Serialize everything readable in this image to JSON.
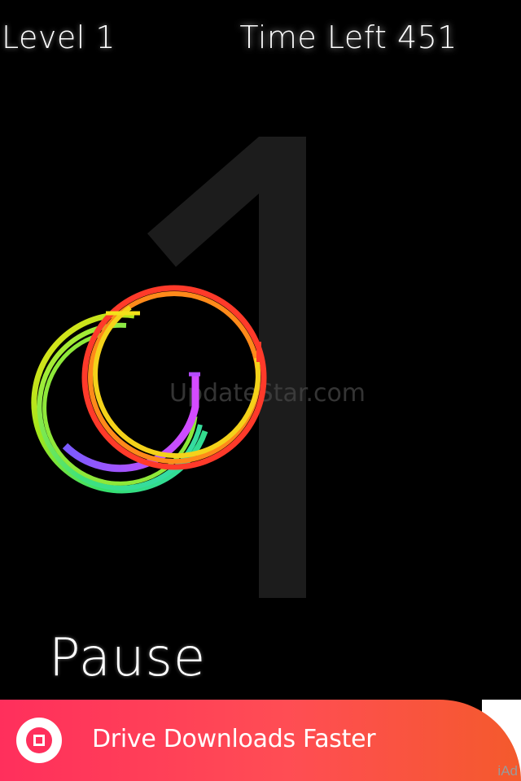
{
  "hud": {
    "level_label": "Level 1",
    "time_left_label": "Time Left 451"
  },
  "background_number": "1",
  "watermark": "UpdateStar.com",
  "controls": {
    "pause_label": "Pause"
  },
  "ad": {
    "text": "Drive Downloads Faster",
    "provider_label": "iAd",
    "icon": "stop-circle-icon"
  },
  "colors": {
    "background": "#000000",
    "ad_gradient_start": "#ff2f5c",
    "ad_gradient_end": "#f45a2c",
    "ring_colors": [
      "#ff3a2a",
      "#ff8a1a",
      "#f4e21a",
      "#a2e61c",
      "#36e06a",
      "#2fd8b8",
      "#b54bff"
    ]
  }
}
